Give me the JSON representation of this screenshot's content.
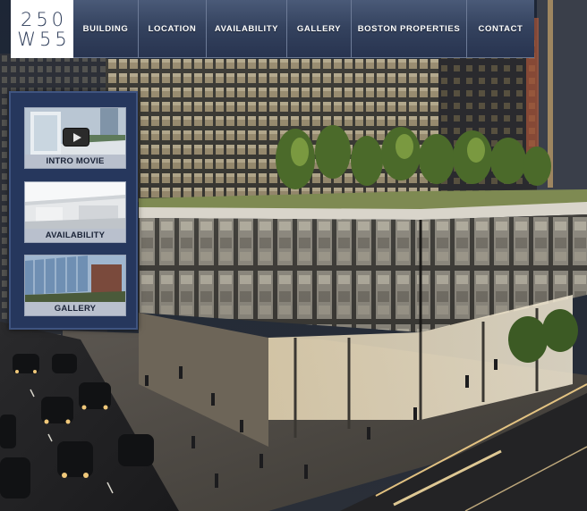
{
  "logo": {
    "line1": "250",
    "line2": "W55"
  },
  "nav": {
    "items": [
      {
        "label": "BUILDING"
      },
      {
        "label": "LOCATION"
      },
      {
        "label": "AVAILABILITY"
      },
      {
        "label": "GALLERY"
      },
      {
        "label": "BOSTON PROPERTIES"
      },
      {
        "label": "CONTACT"
      }
    ]
  },
  "side_panel": {
    "items": [
      {
        "caption": "INTRO MOVIE",
        "icon": "play-icon"
      },
      {
        "caption": "AVAILABILITY"
      },
      {
        "caption": "GALLERY"
      }
    ]
  },
  "colors": {
    "nav_bg": "#34425e",
    "panel_bg": "#26375d",
    "logo_text": "#2c3b58",
    "caption_bg": "#b9c0cd"
  }
}
